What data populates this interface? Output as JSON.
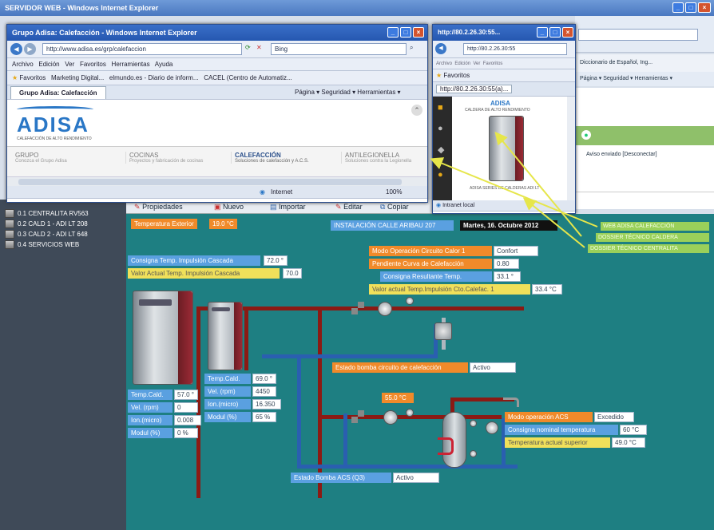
{
  "outer_window": {
    "title": "SERVIDOR WEB - Windows Internet Explorer",
    "address_fragment": "Diccionario de Español, Ing...",
    "command_bar": "Página ▾ Seguridad ▾ Herramientas ▾"
  },
  "front_window": {
    "title": "Grupo Adisa: Calefacción - Windows Internet Explorer",
    "url": "http://www.adisa.es/grp/calefaccion",
    "search_placeholder": "Bing",
    "menu": [
      "Archivo",
      "Edición",
      "Ver",
      "Favoritos",
      "Herramientas",
      "Ayuda"
    ],
    "favorites_label": "Favoritos",
    "favorites": [
      "Marketing Digital...",
      "elmundo.es - Diario de inform...",
      "CACEL (Centro de Automatiz..."
    ],
    "tab_title": "Grupo Adisa: Calefacción",
    "command_bar": "Página ▾ Seguridad ▾ Herramientas ▾",
    "logo": "ADISA",
    "logo_tagline": "CALEFACCIÓN DE ALTO RENDIMIENTO",
    "nav": [
      {
        "title": "GRUPO",
        "sub": "Conozca el Grupo Adisa"
      },
      {
        "title": "COCINAS",
        "sub": "Proyectos y fabricación de cocinas"
      },
      {
        "title": "CALEFACCIÓN",
        "sub": "Soluciones de calefacción y A.C.S."
      },
      {
        "title": "ANTILEGIONELLA",
        "sub": "Soluciones contra la Legionella"
      }
    ],
    "status_zone": "Internet",
    "zoom": "100%"
  },
  "mini_window": {
    "title": "http://80.2.26.30:55...",
    "url": "http://80.2.26.30:55",
    "tab_title": "http://80.2.26.30:55(a)...",
    "favorites_label": "Favoritos",
    "brand": "ADISA",
    "product": "CALDERA DE ALTO RENDIMIENTO",
    "caption": "ADISA SERIES DE CALDERAS ADI LT",
    "status": "Intranet local"
  },
  "behind_strip": {
    "item": "Aviso enviado [Desconectar]"
  },
  "sidebar": {
    "items": [
      "0.1 CENTRALITA RV563",
      "0.2 CALD 1 - ADI LT 208",
      "0.3 CALD 2 - ADI LT 648",
      "0.4 SERVICIOS WEB"
    ]
  },
  "toolbar": {
    "properties": "Propiedades",
    "new": "Nuevo",
    "import": "Importar",
    "edit": "Editar",
    "copy": "Copiar"
  },
  "scada": {
    "outdoor_label": "Temperatura Exterior",
    "outdoor_value": "19.0 °C",
    "install_title": "INSTALACIÓN CALLE ARIBAU 207",
    "date": "Martes, 16. Octubre 2012",
    "cascade_setpoint_label": "Consigna Temp. Impulsión Cascada",
    "cascade_setpoint_value": "72.0 °",
    "cascade_actual_label": "Valor Actual Temp. Impulsión Cascada",
    "cascade_actual_value": "70.0",
    "heating_circuit": [
      {
        "label": "Modo Operación Circuito Calor 1",
        "value": "Confort"
      },
      {
        "label": "Pendiente Curva de Calefacción",
        "value": "0.80"
      },
      {
        "label": "Consigna Resultante Temp.",
        "value": "33.1 °"
      },
      {
        "label": "Valor actual Temp.Impulsión Cto.Calefac. 1",
        "value": "33.4 °C"
      }
    ],
    "boiler1": [
      {
        "label": "Temp.Cald.",
        "value": "57.0 °"
      },
      {
        "label": "Vel. (rpm)",
        "value": "0"
      },
      {
        "label": "Ion.(micro)",
        "value": "0.008"
      },
      {
        "label": "Modul (%)",
        "value": "0 %"
      }
    ],
    "boiler2": [
      {
        "label": "Temp.Cald.",
        "value": "69.0 °"
      },
      {
        "label": "Vel. (rpm)",
        "value": "4450"
      },
      {
        "label": "Ion.(micro)",
        "value": "16.350"
      },
      {
        "label": "Modul (%)",
        "value": "65 %"
      }
    ],
    "pump_heating_label": "Estado bomba circuito de calefacción",
    "pump_heating_value": "Activo",
    "dhw_flow_temp": "55.0 °C",
    "dhw": [
      {
        "label": "Modo operación ACS",
        "value": "Excedido"
      },
      {
        "label": "Consigna nominal temperatura",
        "value": "60 °C"
      },
      {
        "label": "Temperatura actual superior",
        "value": "49.0 °C"
      }
    ],
    "pump_dhw_label": "Estado Bomba ACS (Q3)",
    "pump_dhw_value": "Activo"
  },
  "callouts": [
    "WEB ADISA CALEFACCIÓN",
    "DOSSIER TÉCNICO CALDERA",
    "DOSSIER TÉCNICO CENTRALITA"
  ],
  "colors": {
    "scada_bg": "#1e7f82",
    "sidebar_bg": "#3f4a58",
    "pipe_hot": "#8b1a14",
    "pipe_cold": "#2a5fb0",
    "label_blue": "#5aa0e0",
    "label_orange": "#f08a2a",
    "label_yellow": "#f0e05a",
    "callout_green": "#9ad05a"
  }
}
